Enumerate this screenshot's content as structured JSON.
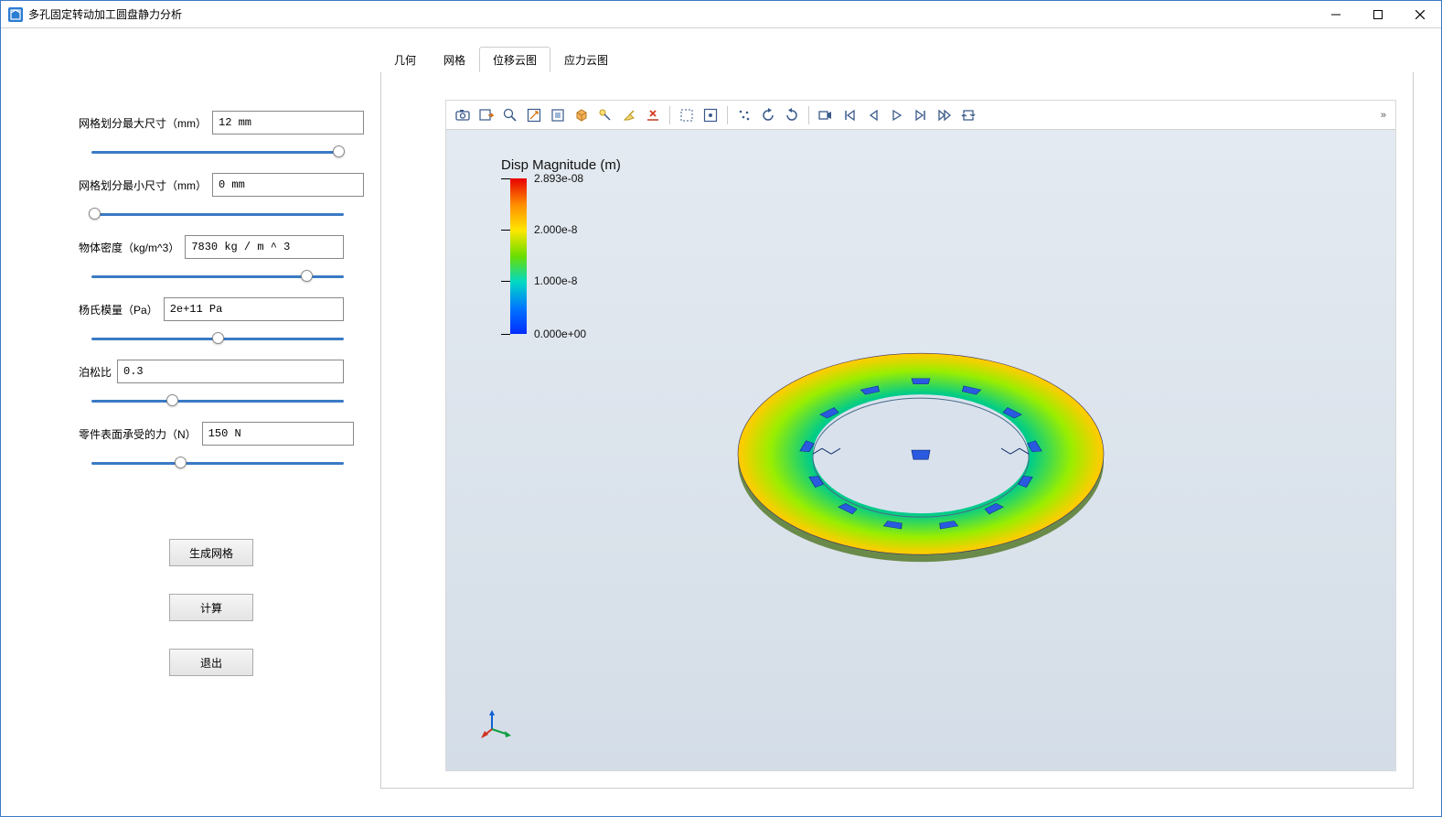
{
  "window": {
    "title": "多孔固定转动加工圆盘静力分析"
  },
  "params": {
    "mesh_max": {
      "label": "网格划分最大尺寸（mm）",
      "value": "12 mm",
      "thumb_pct": 98
    },
    "mesh_min": {
      "label": "网格划分最小尺寸（mm）",
      "value": "0 mm",
      "thumb_pct": 1
    },
    "density": {
      "label": "物体密度（kg/m^3）",
      "value": "7830 kg / m ^ 3",
      "thumb_pct": 85
    },
    "youngs": {
      "label": "杨氏模量（Pa）",
      "value": "2e+11 Pa",
      "thumb_pct": 50
    },
    "poisson": {
      "label": "泊松比",
      "value": "0.3",
      "thumb_pct": 32
    },
    "force": {
      "label": "零件表面承受的力（N）",
      "value": "150 N",
      "thumb_pct": 35
    }
  },
  "buttons": {
    "generate_mesh": "生成网格",
    "compute": "计算",
    "exit": "退出"
  },
  "tabs": {
    "geometry": "几何",
    "mesh": "网格",
    "displacement": "位移云图",
    "stress": "应力云图",
    "active": "displacement"
  },
  "legend": {
    "title": "Disp Magnitude (m)",
    "max": "2.893e-08",
    "t2": "2.000e-8",
    "t1": "1.000e-8",
    "min": "0.000e+00"
  },
  "toolbar_chevrons": "»"
}
